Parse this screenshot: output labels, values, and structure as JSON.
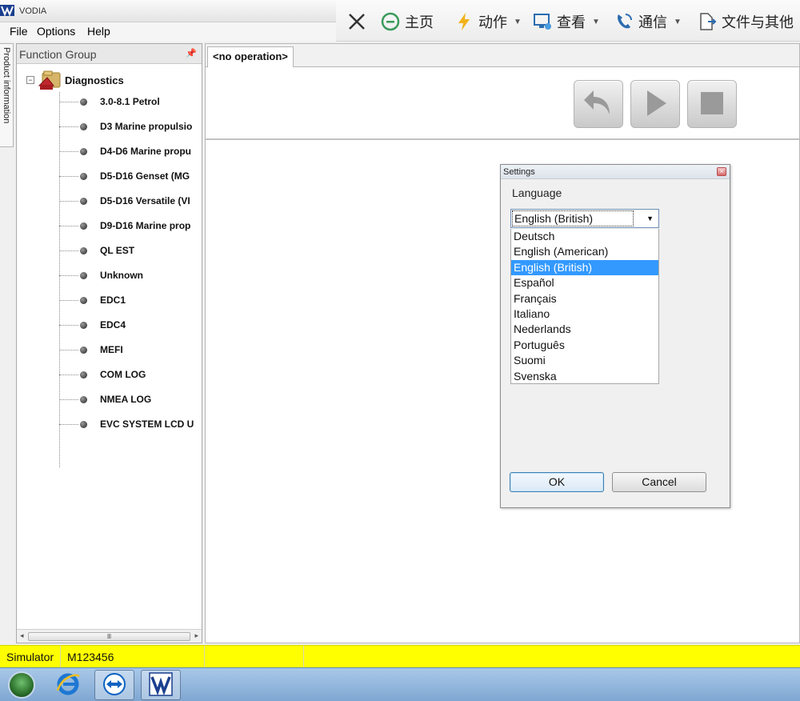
{
  "window": {
    "title": "VODIA"
  },
  "menu": {
    "items": [
      "File",
      "Options",
      "Help"
    ]
  },
  "toolbar": {
    "items": [
      {
        "label": "主页",
        "icon": "home-icon",
        "has_caret": false
      },
      {
        "label": "动作",
        "icon": "lightning-icon",
        "has_caret": true
      },
      {
        "label": "查看",
        "icon": "monitor-icon",
        "has_caret": true
      },
      {
        "label": "通信",
        "icon": "phone-icon",
        "has_caret": true
      },
      {
        "label": "文件与其他",
        "icon": "file-transfer-icon",
        "has_caret": false
      }
    ],
    "close_icon": "close-icon"
  },
  "side_tab": {
    "label": "Product information"
  },
  "function_group": {
    "title": "Function Group",
    "pin_icon": "pin-icon",
    "root": {
      "label": "Diagnostics",
      "expanded": true,
      "items": [
        "3.0-8.1 Petrol",
        "D3 Marine propulsio",
        "D4-D6 Marine propu",
        "D5-D16 Genset (MG",
        "D5-D16 Versatile (VI",
        "D9-D16 Marine prop",
        "QL EST",
        "Unknown",
        "EDC1",
        "EDC4",
        "MEFI",
        "COM LOG",
        "NMEA LOG",
        "EVC SYSTEM LCD U"
      ]
    }
  },
  "main": {
    "tab_label": "<no operation>",
    "controls": [
      "back-icon",
      "play-icon",
      "stop-icon"
    ]
  },
  "settings_dialog": {
    "title": "Settings",
    "language_label": "Language",
    "selected_language": "English (British)",
    "options": [
      "Deutsch",
      "English (American)",
      "English (British)",
      "Español",
      "Français",
      "Italiano",
      "Nederlands",
      "Português",
      "Suomi",
      "Svenska"
    ],
    "ok_label": "OK",
    "cancel_label": "Cancel"
  },
  "statusbar": {
    "mode": "Simulator",
    "id": "M123456"
  },
  "taskbar": {
    "items": [
      "start-orb-icon",
      "internet-explorer-icon",
      "teamviewer-icon",
      "vodia-icon"
    ]
  },
  "colors": {
    "status_yellow": "#ffff00",
    "selection_blue": "#3399ff"
  }
}
